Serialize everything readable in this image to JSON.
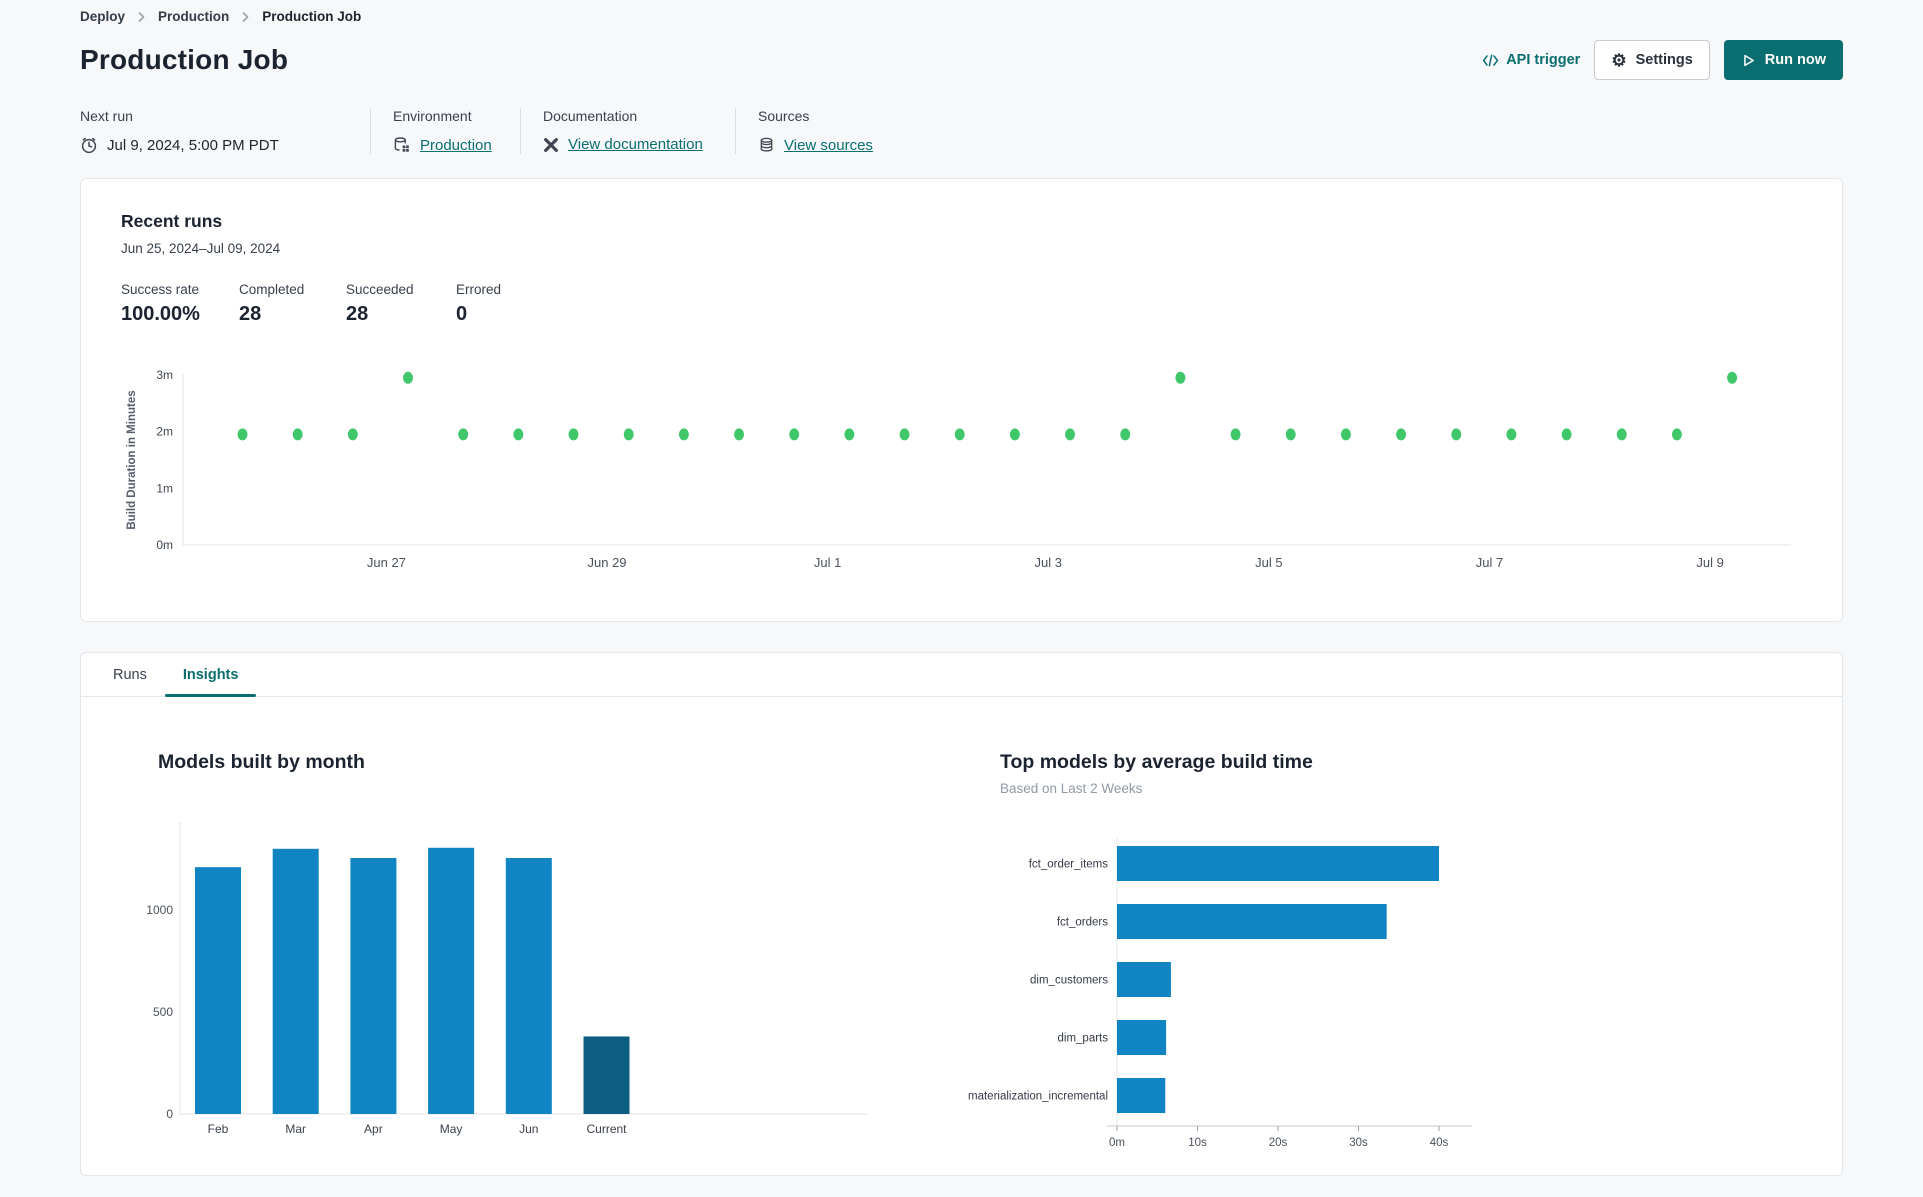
{
  "colors": {
    "accent_teal": "#0a6e71",
    "bar_blue": "#1184c4",
    "bar_dark_blue": "#0d5d82",
    "dot_green": "#3fc76a",
    "axis_line": "#e2e5e9",
    "axis_text": "#4b525c",
    "page_bg": "#f7f8fa"
  },
  "breadcrumb": {
    "items": [
      "Deploy",
      "Production",
      "Production Job"
    ]
  },
  "header": {
    "title": "Production Job",
    "api_trigger_label": "API trigger",
    "settings_label": "Settings",
    "run_now_label": "Run now"
  },
  "meta": {
    "next_run": {
      "label": "Next run",
      "value": "Jul 9, 2024, 5:00 PM PDT"
    },
    "environment": {
      "label": "Environment",
      "value": "Production"
    },
    "documentation": {
      "label": "Documentation",
      "value": "View documentation"
    },
    "sources": {
      "label": "Sources",
      "value": "View sources"
    }
  },
  "recent_runs": {
    "title": "Recent runs",
    "date_range": "Jun 25, 2024–Jul 09, 2024",
    "stats": [
      {
        "label": "Success rate",
        "value": "100.00%"
      },
      {
        "label": "Completed",
        "value": "28"
      },
      {
        "label": "Succeeded",
        "value": "28"
      },
      {
        "label": "Errored",
        "value": "0"
      }
    ]
  },
  "tabs": {
    "runs": "Runs",
    "insights": "Insights"
  },
  "chart_data": [
    {
      "id": "build-duration-scatter",
      "type": "scatter",
      "ylabel": "Build Duration in Minutes",
      "ylim": [
        0,
        3.2
      ],
      "y_ticks": [
        {
          "v": 0,
          "label": "0m"
        },
        {
          "v": 1,
          "label": "1m"
        },
        {
          "v": 2,
          "label": "2m"
        },
        {
          "v": 3,
          "label": "3m"
        }
      ],
      "x_ticks": [
        "Jun 27",
        "Jun 29",
        "Jul 1",
        "Jul 3",
        "Jul 5",
        "Jul 7",
        "Jul 9"
      ],
      "points_build_minutes": [
        1.95,
        1.95,
        1.95,
        2.95,
        1.95,
        1.95,
        1.95,
        1.95,
        1.95,
        1.95,
        1.95,
        1.95,
        1.95,
        1.95,
        1.95,
        1.95,
        1.95,
        2.95,
        1.95,
        1.95,
        1.95,
        1.95,
        1.95,
        1.95,
        1.95,
        1.95,
        1.95,
        2.95
      ],
      "point_color": "#3fc76a",
      "grid": false,
      "layout_hints": {
        "x_start_frac": 0.037,
        "x_step_frac": 0.03431,
        "tick_start_frac": 0.1265,
        "tick_step_frac": 0.1372
      }
    },
    {
      "id": "models-built-by-month",
      "type": "bar",
      "title": "Models built by month",
      "categories": [
        "Feb",
        "Mar",
        "Apr",
        "May",
        "Jun",
        "Current"
      ],
      "values": [
        1210,
        1300,
        1255,
        1305,
        1255,
        380
      ],
      "y_ticks": [
        0,
        500,
        1000
      ],
      "ylim": [
        0,
        1430
      ],
      "bar_colors": [
        "#1184c4",
        "#1184c4",
        "#1184c4",
        "#1184c4",
        "#1184c4",
        "#0d5d82"
      ],
      "grid": false
    },
    {
      "id": "top-models-by-average-build-time",
      "type": "bar-horizontal",
      "title": "Top models by average build time",
      "subtitle": "Based on Last 2 Weeks",
      "categories": [
        "fct_order_items",
        "fct_orders",
        "dim_customers",
        "dim_parts",
        "materialization_incremental"
      ],
      "values_seconds": [
        40,
        33.5,
        6.7,
        6.1,
        6.0
      ],
      "x_ticks": [
        {
          "v": 0,
          "label": "0m"
        },
        {
          "v": 10,
          "label": "10s"
        },
        {
          "v": 20,
          "label": "20s"
        },
        {
          "v": 30,
          "label": "30s"
        },
        {
          "v": 40,
          "label": "40s"
        }
      ],
      "xlim": [
        0,
        44
      ],
      "bar_color": "#1184c4",
      "grid": false
    }
  ]
}
